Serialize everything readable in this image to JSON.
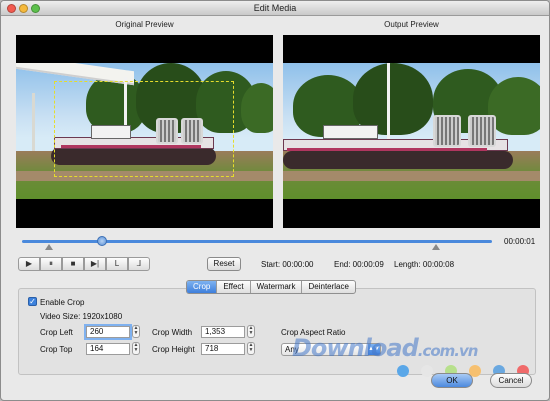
{
  "window": {
    "title": "Edit Media"
  },
  "preview": {
    "original_label": "Original Preview",
    "output_label": "Output Preview"
  },
  "timeline": {
    "position_fraction": 0.17,
    "end_time": "00:00:01"
  },
  "playback": {
    "buttons": [
      {
        "name": "play-button",
        "glyph": "▶"
      },
      {
        "name": "pause-button",
        "glyph": "⏸"
      },
      {
        "name": "stop-button",
        "glyph": "■"
      },
      {
        "name": "next-frame-button",
        "glyph": "▶|"
      },
      {
        "name": "mark-in-button",
        "glyph": "L"
      },
      {
        "name": "mark-out-button",
        "glyph": "⅃"
      }
    ],
    "reset_label": "Reset",
    "start": "Start: 00:00:00",
    "end": "End: 00:00:09",
    "length": "Length: 00:00:08"
  },
  "tabs": [
    {
      "label": "Crop",
      "active": true
    },
    {
      "label": "Effect",
      "active": false
    },
    {
      "label": "Watermark",
      "active": false
    },
    {
      "label": "Deinterlace",
      "active": false
    }
  ],
  "crop": {
    "enable_label": "Enable Crop",
    "enabled": true,
    "video_size": "Video Size: 1920x1080",
    "crop_left_label": "Crop Left",
    "crop_left": "260",
    "crop_top_label": "Crop Top",
    "crop_top": "164",
    "crop_width_label": "Crop Width",
    "crop_width": "1,353",
    "crop_height_label": "Crop Height",
    "crop_height": "718",
    "aspect_label": "Crop Aspect Ratio",
    "aspect_value": "Any"
  },
  "watermark_text": {
    "main": "Download",
    "suffix": ".com.vn"
  },
  "watermark_dot_colors": [
    "#5aa7e8",
    "#e6e6e6",
    "#b7e08c",
    "#f6c070",
    "#6aa8e0",
    "#f06a6a"
  ],
  "footer": {
    "ok_label": "OK",
    "cancel_label": "Cancel"
  },
  "colors": {
    "accent": "#3e7fdc",
    "crop_guide": "#e5dd2c"
  }
}
